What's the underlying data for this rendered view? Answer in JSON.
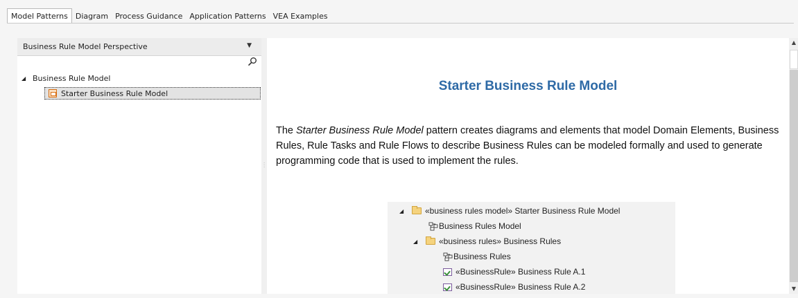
{
  "tabs": [
    {
      "label": "Model Patterns",
      "active": true
    },
    {
      "label": "Diagram",
      "active": false
    },
    {
      "label": "Process Guidance",
      "active": false
    },
    {
      "label": "Application Patterns",
      "active": false
    },
    {
      "label": "VEA Examples",
      "active": false
    }
  ],
  "left_panel": {
    "perspective": "Business Rule Model Perspective",
    "tree": {
      "root_label": "Business Rule Model",
      "selected_item": "Starter Business Rule Model"
    }
  },
  "content": {
    "heading": "Starter Business Rule Model",
    "paragraph": {
      "prefix": "The ",
      "emphasis": "Starter Business Rule Model",
      "suffix": " pattern creates diagrams and elements that model Domain Elements, Business Rules, Rule Tasks and Rule Flows to describe Business Rules can be modeled formally and used to generate programming code that is used to implement the rules."
    },
    "pattern_tree": [
      {
        "text": "«business rules model» Starter Business Rule Model",
        "icon": "folder-icon"
      },
      {
        "text": "Business Rules Model",
        "icon": "diagram-icon"
      },
      {
        "text": "«business rules» Business Rules",
        "icon": "folder-icon"
      },
      {
        "text": "Business Rules",
        "icon": "diagram-icon"
      },
      {
        "text": "«BusinessRule» Business Rule A.1",
        "icon": "rule-icon"
      },
      {
        "text": "«BusinessRule» Business Rule A.2",
        "icon": "rule-icon"
      }
    ]
  },
  "colors": {
    "heading": "#2e6aa6",
    "selection": "#e3e3e3",
    "tree_background": "#f2f2f2"
  }
}
